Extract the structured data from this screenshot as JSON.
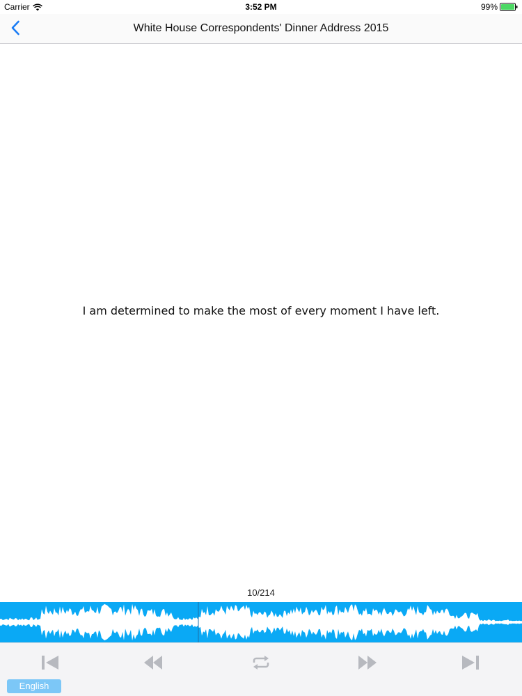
{
  "status_bar": {
    "carrier": "Carrier",
    "time": "3:52 PM",
    "battery": "99%",
    "icons": [
      "wifi-icon",
      "battery-icon"
    ]
  },
  "nav": {
    "back_icon": "chevron-left-icon",
    "title": "White House Correspondents' Dinner Address 2015"
  },
  "main": {
    "sentence": "I am determined to make the most of every moment I have left.",
    "counter": "10/214"
  },
  "waveform": {
    "played_fraction": 0.38
  },
  "toolbar": {
    "controls": [
      "skip-to-start-icon",
      "rewind-icon",
      "repeat-icon",
      "fast-forward-icon",
      "skip-to-end-icon"
    ],
    "language_label": "English"
  },
  "colors": {
    "accent": "#0aa9f5",
    "back_arrow": "#1a7cf5",
    "controls": "#b7b9bf",
    "language_button": "#7cc7f7"
  }
}
